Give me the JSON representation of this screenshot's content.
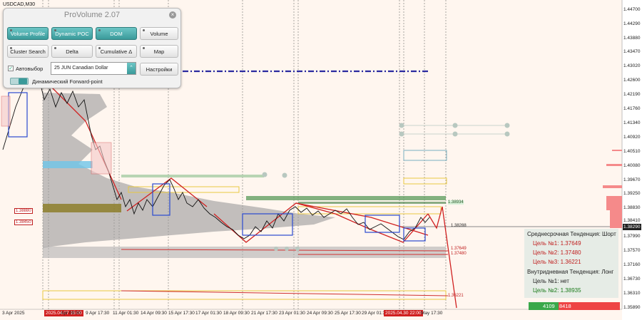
{
  "symbol": "USDCAD,M30",
  "panel": {
    "title": "ProVolume 2.07",
    "close": "×",
    "buttons": {
      "volume_profile": "Volume Profile",
      "dynamic_poc": "Dynamic POC",
      "dom": "DOM",
      "volume": "Volume",
      "cluster_search": "Cluster Search",
      "delta": "Delta",
      "cumulative_delta": "Cumulative Δ",
      "map": "Map"
    },
    "auto_select_label": "Автовыбор",
    "auto_select_checked": true,
    "instrument": "25 JUN Canadian Dollar",
    "settings_label": "Настройки",
    "forward_point_label": "Динамический Forward-point"
  },
  "price_axis": [
    "1.44700",
    "1.44290",
    "1.43880",
    "1.43470",
    "1.43020",
    "1.42600",
    "1.42190",
    "1.41760",
    "1.41340",
    "1.40920",
    "1.40510",
    "1.40080",
    "1.39670",
    "1.39250",
    "1.38830",
    "1.38410",
    "1.38290",
    "1.37990",
    "1.37570",
    "1.37160",
    "1.36730",
    "1.36310",
    "1.35890"
  ],
  "current_price": "1.38290",
  "time_axis": [
    "3 Apr 2025",
    "Apr 09:30",
    "9 Apr 17:30",
    "11 Apr 01:30",
    "14 Apr 09:30",
    "15 Apr 17:30",
    "17 Apr 01:30",
    "18 Apr 09:30",
    "21 Apr 17:30",
    "23 Apr 01:30",
    "24 Apr 09:30",
    "25 Apr 17:30",
    "29 Apr 01:30",
    "May 17:30"
  ],
  "time_highlights": [
    "2025.04.07 15:00",
    "2025.04.30 22:00"
  ],
  "level_tags": [
    "1.38880",
    "1.38450"
  ],
  "level_texts": [
    "1.38934",
    "1.38288",
    "1.37649",
    "1.37480",
    "1.36221"
  ],
  "targets": {
    "medium_label": "Среднесрочная Тенденция: Шорт",
    "t1": "Цель №1: 1.37649",
    "t2": "Цель №2: 1.37480",
    "t3": "Цель №3: 1.36221",
    "intraday_label": "Внутридневная Тенденция: Лонг",
    "i1": "Цель №1: нет",
    "i2": "Цель №2: 1.38935"
  },
  "volume": {
    "buy": "4109",
    "sell": "8418"
  },
  "colors": {
    "accent": "#3a9a9a",
    "down": "#c02020",
    "dashed_level": "#2a2aa0",
    "green_level": "#5a9a5a"
  }
}
